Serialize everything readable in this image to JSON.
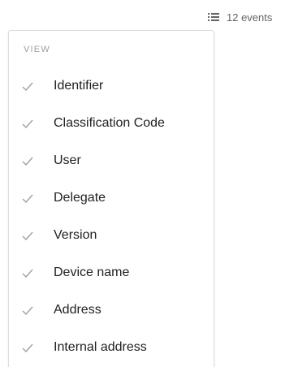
{
  "toolbar": {
    "icon": "list-view-icon",
    "events_label": "12 events"
  },
  "menu": {
    "section_title": "VIEW",
    "items": [
      {
        "label": "Identifier",
        "checked": true
      },
      {
        "label": "Classification Code",
        "checked": true
      },
      {
        "label": "User",
        "checked": true
      },
      {
        "label": "Delegate",
        "checked": true
      },
      {
        "label": "Version",
        "checked": true
      },
      {
        "label": "Device name",
        "checked": true
      },
      {
        "label": "Address",
        "checked": true
      },
      {
        "label": "Internal address",
        "checked": true
      }
    ]
  },
  "colors": {
    "text_primary": "#202124",
    "text_secondary": "#5f6368",
    "section_title": "#9aa0a6",
    "check": "#9aa0a6",
    "border": "#dadce0"
  }
}
